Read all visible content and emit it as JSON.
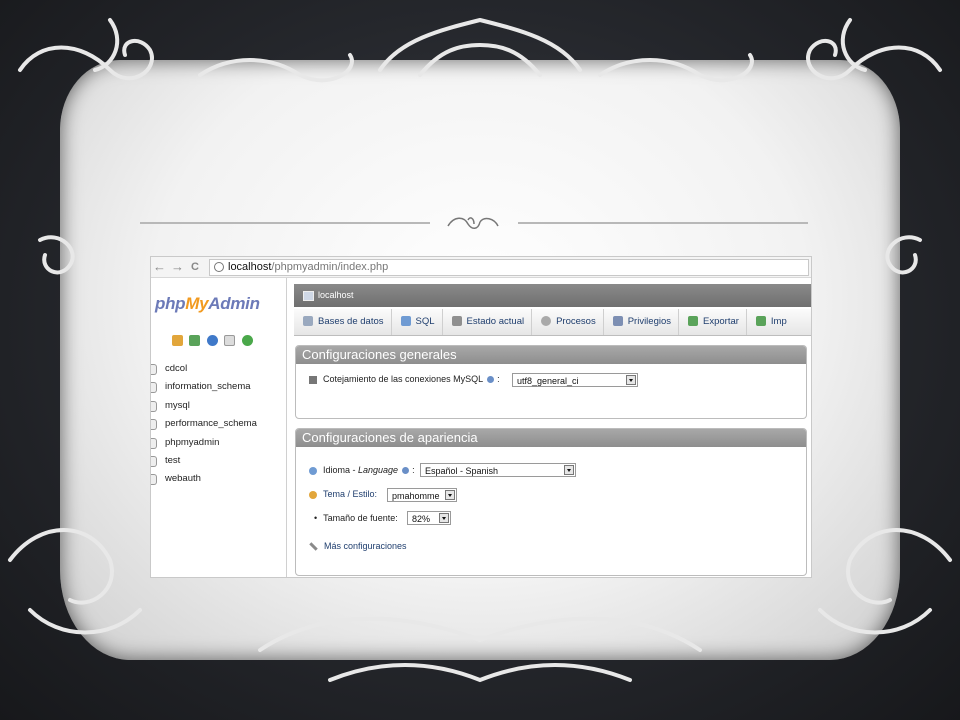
{
  "browser": {
    "url_host": "localhost",
    "url_path": "/phpmyadmin/index.php",
    "back_glyph": "←",
    "forward_glyph": "→",
    "reload_glyph": "C"
  },
  "sidebar": {
    "logo_php": "php",
    "logo_my": "My",
    "logo_admin": "Admin",
    "icons": [
      "home-icon",
      "logout-icon",
      "help-icon",
      "docs-icon",
      "reload-icon"
    ],
    "databases": [
      "cdcol",
      "information_schema",
      "mysql",
      "performance_schema",
      "phpmyadmin",
      "test",
      "webauth"
    ]
  },
  "main": {
    "server_label": "localhost",
    "tabs": [
      {
        "label": "Bases de datos",
        "icon": "database-icon"
      },
      {
        "label": "SQL",
        "icon": "sql-icon"
      },
      {
        "label": "Estado actual",
        "icon": "status-icon"
      },
      {
        "label": "Procesos",
        "icon": "processes-icon"
      },
      {
        "label": "Privilegios",
        "icon": "privileges-icon"
      },
      {
        "label": "Exportar",
        "icon": "export-icon"
      },
      {
        "label": "Imp",
        "icon": "import-icon"
      }
    ],
    "general": {
      "title": "Configuraciones generales",
      "collation_label": "Cotejamiento de las conexiones MySQL",
      "collation_value": "utf8_general_ci",
      "colon": ":"
    },
    "appearance": {
      "title": "Configuraciones de apariencia",
      "language_label_prefix": "Idioma - ",
      "language_label_italic": "Language",
      "language_value": "Español - Spanish",
      "theme_label": "Tema / Estilo:",
      "theme_value": "pmahomme",
      "font_size_label": "Tamaño de fuente:",
      "font_size_value": "82%",
      "more_settings": "Más configuraciones",
      "bullet": "•",
      "colon": ":"
    }
  },
  "colors": {
    "background": "#25272c",
    "panel_title_bg": "#9a9a9a",
    "tab_text": "#1f3e6e",
    "logo_blue": "#6c7ab8",
    "logo_orange": "#f29a1f"
  }
}
